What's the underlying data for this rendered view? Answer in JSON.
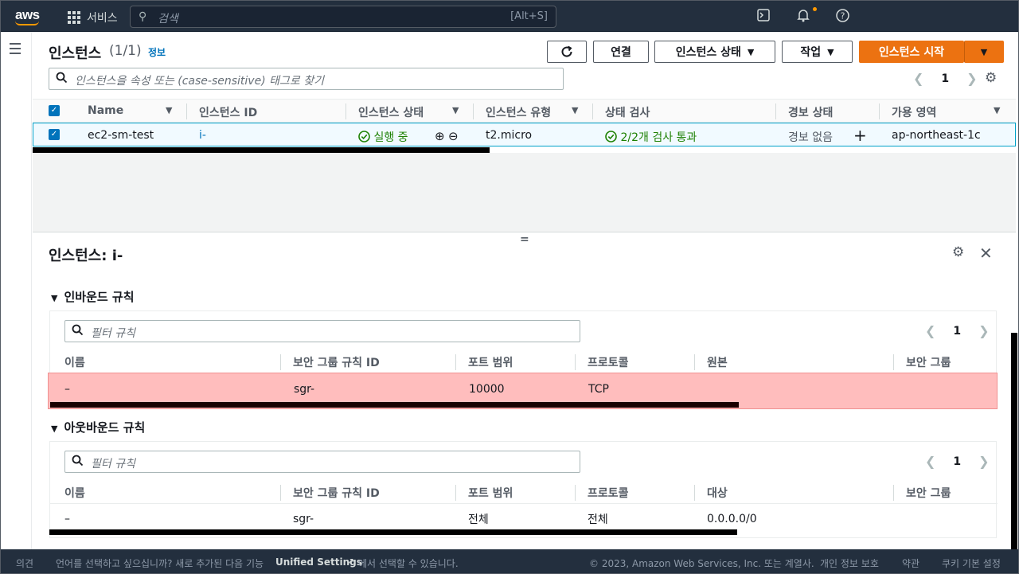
{
  "topbar": {
    "logo": "aws",
    "services_label": "서비스",
    "search_placeholder": "검색",
    "search_shortcut": "[Alt+S]",
    "icons": [
      "cloudshell-icon",
      "bell-icon",
      "help-icon"
    ]
  },
  "instances": {
    "title": "인스턴스",
    "count": "(1/1)",
    "info_link": "정보",
    "buttons": {
      "refresh": "refresh-icon",
      "connect": "연결",
      "instance_state": "인스턴스 상태",
      "actions": "작업",
      "launch": "인스턴스 시작"
    },
    "filter_placeholder": "인스턴스을 속성 또는 (case-sensitive) 태그로 찾기",
    "page": "1",
    "columns": [
      "Name",
      "인스턴스 ID",
      "인스턴스 상태",
      "인스턴스 유형",
      "상태 검사",
      "경보 상태",
      "가용 영역"
    ],
    "rows": [
      {
        "name": "ec2-sm-test",
        "id": "i-",
        "state": "실행 중",
        "type": "t2.micro",
        "checks": "2/2개 검사 통과",
        "alarm": "경보 없음",
        "az": "ap-northeast-1c"
      }
    ]
  },
  "details": {
    "title": "인스턴스: i-",
    "inbound": {
      "title": "인바운드 규칙",
      "filter_placeholder": "필터 규칙",
      "page": "1",
      "columns": [
        "이름",
        "보안 그룹 규칙 ID",
        "포트 범위",
        "프로토콜",
        "원본",
        "보안 그룹"
      ],
      "rows": [
        {
          "name": "–",
          "rule_id": "sgr-",
          "port": "10000",
          "protocol": "TCP",
          "source": "",
          "group": ""
        }
      ]
    },
    "outbound": {
      "title": "아웃바운드 규칙",
      "filter_placeholder": "필터 규칙",
      "page": "1",
      "columns": [
        "이름",
        "보안 그룹 규칙 ID",
        "포트 범위",
        "프로토콜",
        "대상",
        "보안 그룹"
      ],
      "rows": [
        {
          "name": "–",
          "rule_id": "sgr-",
          "port": "전체",
          "protocol": "전체",
          "dest": "0.0.0.0/0",
          "group": ""
        }
      ]
    }
  },
  "footer": {
    "feedback": "의견",
    "notice_before": "언어를 선택하고 싶으십니까? 새로 추가된 다음 기능",
    "unified": "Unified Settings",
    "notice_after": "에서 선택할 수 있습니다.",
    "copyright": "© 2023, Amazon Web Services, Inc. 또는 계열사.",
    "privacy": "개인 정보 보호",
    "terms": "약관",
    "cookies": "쿠키 기본 설정"
  }
}
